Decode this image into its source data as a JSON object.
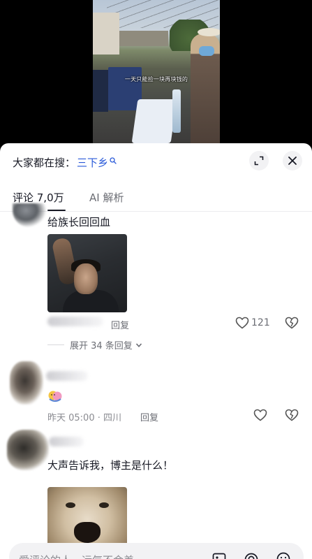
{
  "video": {
    "caption": "一天只能捡一块再块钱的"
  },
  "search": {
    "prefix": "大家都在搜：",
    "term": "三下乡"
  },
  "tabs": {
    "comments_label": "评论 7,0万",
    "ai_label": "AI 解析"
  },
  "comments": [
    {
      "text": "给族长回回血",
      "reply_label": "回复",
      "likes": "121",
      "expand_label": "展开 34 条回复"
    },
    {
      "meta": "昨天 05:00 · 四川",
      "reply_label": "回复"
    },
    {
      "text": "大声告诉我，博主是什么！"
    }
  ],
  "input": {
    "placeholder": "爱评论的人，运气不会差"
  },
  "colors": {
    "accent_link": "#2a5ad9",
    "text_primary": "#161823",
    "text_secondary": "#8a8b91"
  },
  "icons": [
    "search-icon",
    "expand-icon",
    "close-icon",
    "heart-icon",
    "dislike-heart-icon",
    "chevron-down-icon",
    "image-icon",
    "at-icon",
    "emoji-icon"
  ]
}
